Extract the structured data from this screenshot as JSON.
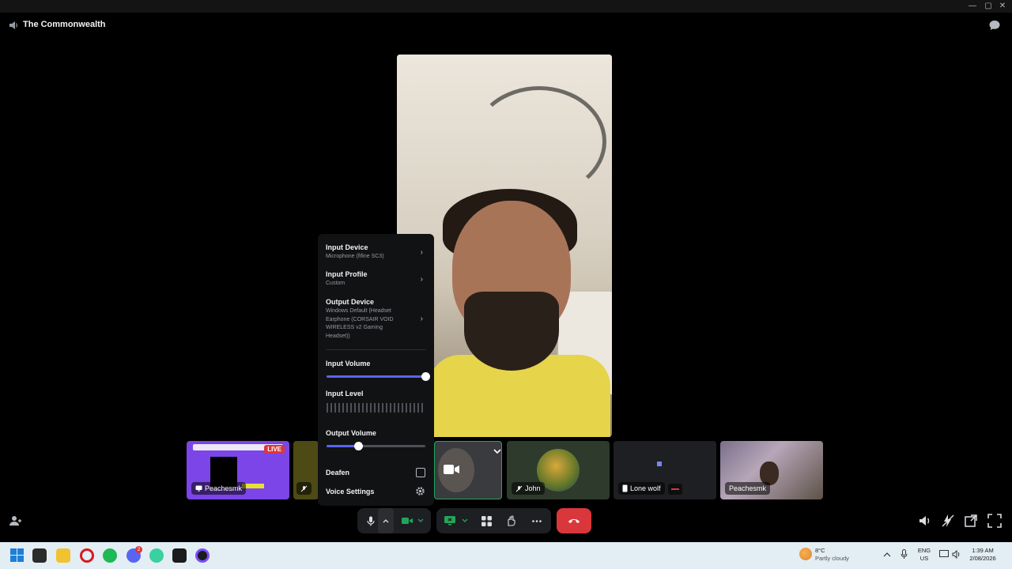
{
  "window": {
    "minimize": "—",
    "maximize": "▢",
    "close": "✕"
  },
  "header": {
    "channel_name": "The Commonwealth",
    "channel_icon": "speaker-icon",
    "chat_icon": "chat-bubble-icon"
  },
  "tiles": [
    {
      "name": "Peachesmk",
      "live": "LIVE",
      "kind": "stream",
      "icon": "screen-icon"
    },
    {
      "name": "",
      "kind": "muted-partial",
      "icon": "mic-off-icon"
    },
    {
      "name": "",
      "kind": "camera",
      "icon": "camera-icon"
    },
    {
      "name": "John",
      "kind": "avatar",
      "icon": "mic-off-icon"
    },
    {
      "name": "Lone wolf",
      "kind": "phone",
      "icon": "phone-icon"
    },
    {
      "name": "Peachesmk",
      "kind": "video",
      "icon": "screen-icon"
    }
  ],
  "voice_menu": {
    "input_device": {
      "title": "Input Device",
      "value": "Microphone (fifine SC3)"
    },
    "input_profile": {
      "title": "Input Profile",
      "value": "Custom"
    },
    "output_device": {
      "title": "Output Device",
      "value": "Windows Default (Headset Earphone (CORSAIR VOID WIRELESS v2 Gaming Headset))"
    },
    "input_volume": {
      "title": "Input Volume",
      "level": 1.0
    },
    "input_level": {
      "title": "Input Level"
    },
    "output_volume": {
      "title": "Output Volume",
      "level": 0.32
    },
    "deafen": {
      "title": "Deafen",
      "checked": false
    },
    "voice_settings": {
      "title": "Voice Settings"
    }
  },
  "taskbar": {
    "weather_temp": "8°C",
    "weather_desc": "Partly cloudy",
    "lang_top": "ENG",
    "lang_bottom": "US",
    "time": "1:39 AM",
    "date": "2/08/2026",
    "discord_badge": "2"
  },
  "colors": {
    "accent": "#5865f2",
    "hangup": "#da373c",
    "live": "#da373c",
    "stream_bg": "#7b45e8"
  }
}
